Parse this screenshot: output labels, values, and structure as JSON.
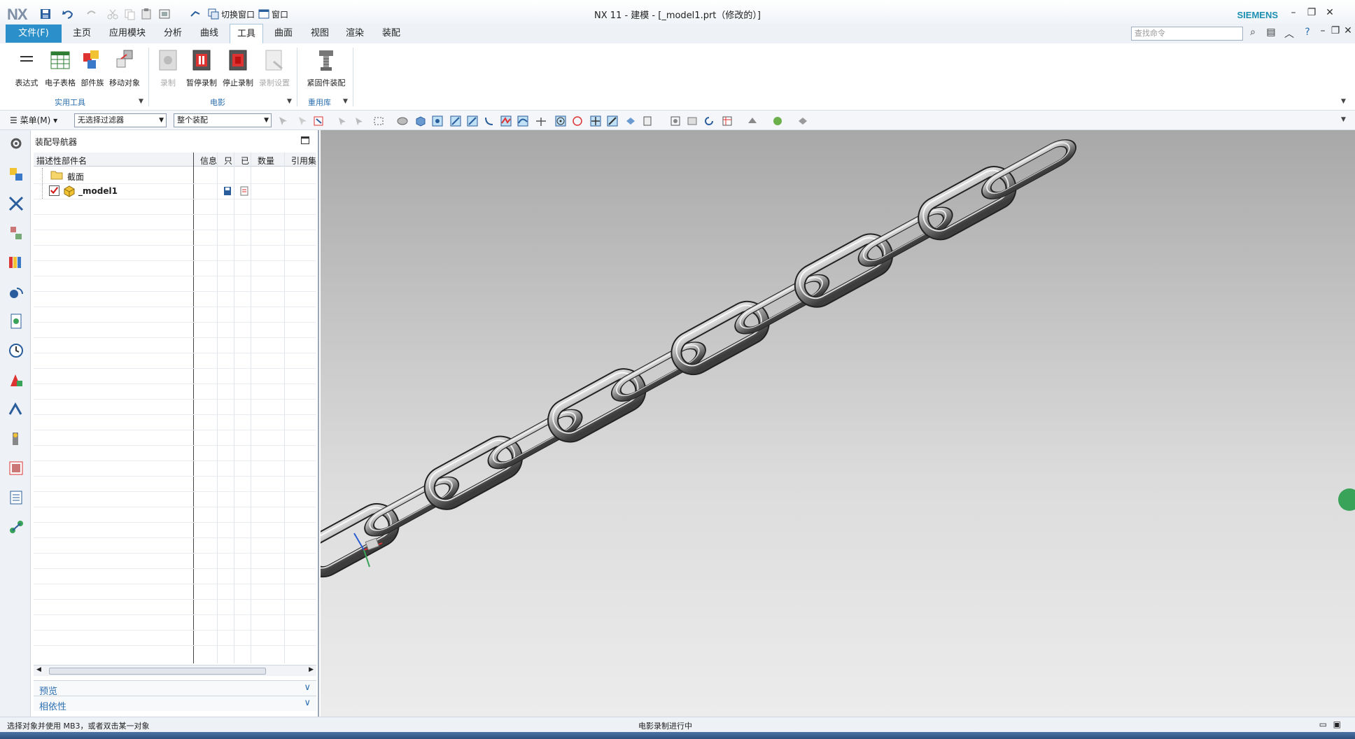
{
  "app": {
    "logo": "NX",
    "window_title": "NX 11 - 建模 - [_model1.prt（修改的）]",
    "brand": "SIEMENS"
  },
  "quick_access": {
    "switch_window": "切换窗口",
    "window": "窗口"
  },
  "tabs": [
    {
      "label": "文件(F)"
    },
    {
      "label": "主页"
    },
    {
      "label": "应用模块"
    },
    {
      "label": "分析"
    },
    {
      "label": "曲线"
    },
    {
      "label": "工具"
    },
    {
      "label": "曲面"
    },
    {
      "label": "视图"
    },
    {
      "label": "渲染"
    },
    {
      "label": "装配"
    }
  ],
  "search": {
    "placeholder": "查找命令"
  },
  "ribbon": {
    "utilities": {
      "label": "实用工具",
      "buttons": [
        {
          "label": "表达式"
        },
        {
          "label": "电子表格"
        },
        {
          "label": "部件族"
        },
        {
          "label": "移动对象"
        }
      ]
    },
    "movie": {
      "label": "电影",
      "buttons": [
        {
          "label": "录制"
        },
        {
          "label": "暂停录制"
        },
        {
          "label": "停止录制"
        },
        {
          "label": "录制设置"
        }
      ]
    },
    "reuse": {
      "label": "重用库",
      "buttons": [
        {
          "label": "紧固件装配"
        }
      ]
    }
  },
  "toolbar": {
    "menu": "菜单(M)",
    "filter": "无选择过滤器",
    "scope": "整个装配"
  },
  "navigator": {
    "title": "装配导航器",
    "columns": [
      "描述性部件名",
      "信息",
      "只",
      "已",
      "数量",
      "引用集"
    ],
    "rows": [
      {
        "name": "截面"
      },
      {
        "name": "_model1"
      }
    ],
    "panels": {
      "preview": "预览",
      "dependencies": "相依性"
    }
  },
  "status": {
    "left": "选择对象并使用 MB3，或者双击某一对象",
    "center": "电影录制进行中"
  },
  "colors": {
    "accent": "#2b8fc9",
    "brand": "#1c8fb0",
    "group_label": "#2b6fb0"
  }
}
